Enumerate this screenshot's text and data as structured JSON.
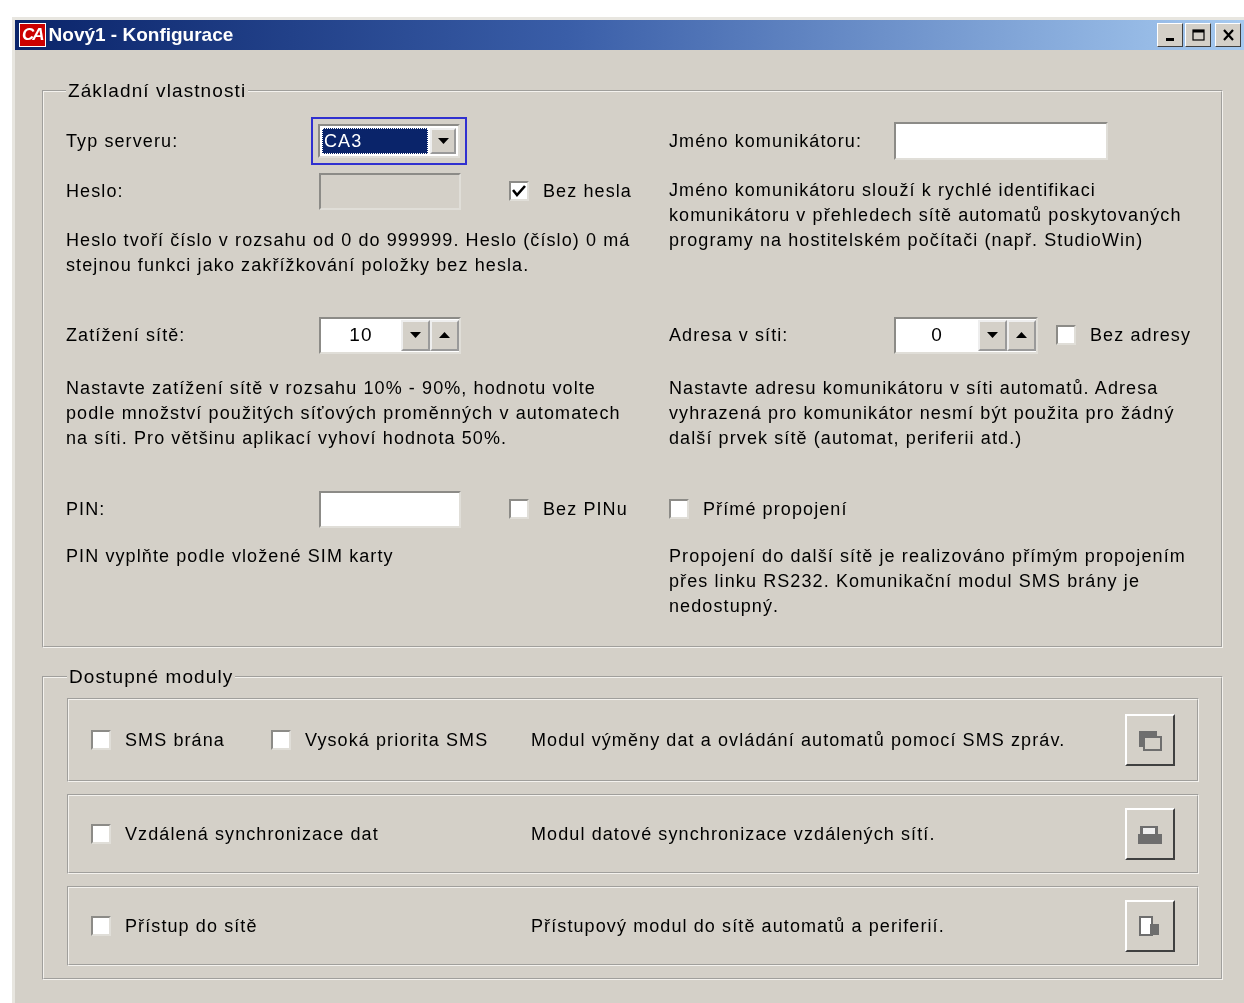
{
  "window": {
    "logo": "CA",
    "title": "Nový1 - Konfigurace"
  },
  "basic_properties": {
    "title": "Základní vlastnosti",
    "server_type": {
      "label": "Typ serveru:",
      "value": "CA3",
      "focused": true
    },
    "password": {
      "label": "Heslo:",
      "disabled": true,
      "no_password": {
        "label": "Bez hesla",
        "checked": true
      },
      "note": "Heslo tvoří číslo v rozsahu od 0 do 999999. Heslo (číslo) 0 má stejnou funkci jako zakřížkování položky bez hesla."
    },
    "communicator_name": {
      "label": "Jméno komunikátoru:",
      "note": "Jméno komunikátoru slouží k rychlé identifikaci komunikátoru v přehledech sítě automatů poskytovaných programy na hostitelském počítači (např. StudioWin)"
    },
    "network_load": {
      "label": "Zatížení sítě:",
      "value": "10",
      "note": "Nastavte zatížení sítě v rozsahu 10% - 90%, hodnotu volte podle množství použitých síťových proměnných v automatech na síti. Pro většinu aplikací vyhoví hodnota 50%."
    },
    "network_address": {
      "label": "Adresa v síti:",
      "value": "0",
      "no_address": {
        "label": "Bez adresy",
        "checked": false
      },
      "note": "Nastavte adresu komunikátoru v síti automatů. Adresa vyhrazená pro komunikátor nesmí být použita pro žádný další prvek sítě (automat, periferii atd.)"
    },
    "pin": {
      "label": "PIN:",
      "no_pin": {
        "label": "Bez PINu",
        "checked": false
      },
      "note": "PIN vyplňte podle vložené SIM karty"
    },
    "direct_connection": {
      "label": "Přímé propojení",
      "checked": false,
      "note": "Propojení do další sítě je realizováno přímým propojením přes linku RS232. Komunikační modul SMS brány je nedostupný."
    }
  },
  "available_modules": {
    "title": "Dostupné moduly",
    "modules": [
      {
        "options": [
          {
            "label": "SMS brána",
            "checked": false
          },
          {
            "label": "Vysoká priorita SMS",
            "checked": false
          }
        ],
        "description": "Modul výměny dat a ovládání automatů pomocí SMS zpráv."
      },
      {
        "options": [
          {
            "label": "Vzdálená synchronizace dat",
            "checked": false
          }
        ],
        "description": "Modul datové synchronizace vzdálených sítí."
      },
      {
        "options": [
          {
            "label": "Přístup do sítě",
            "checked": false
          }
        ],
        "description": "Přístupový modul do sítě automatů a periferií."
      }
    ]
  }
}
